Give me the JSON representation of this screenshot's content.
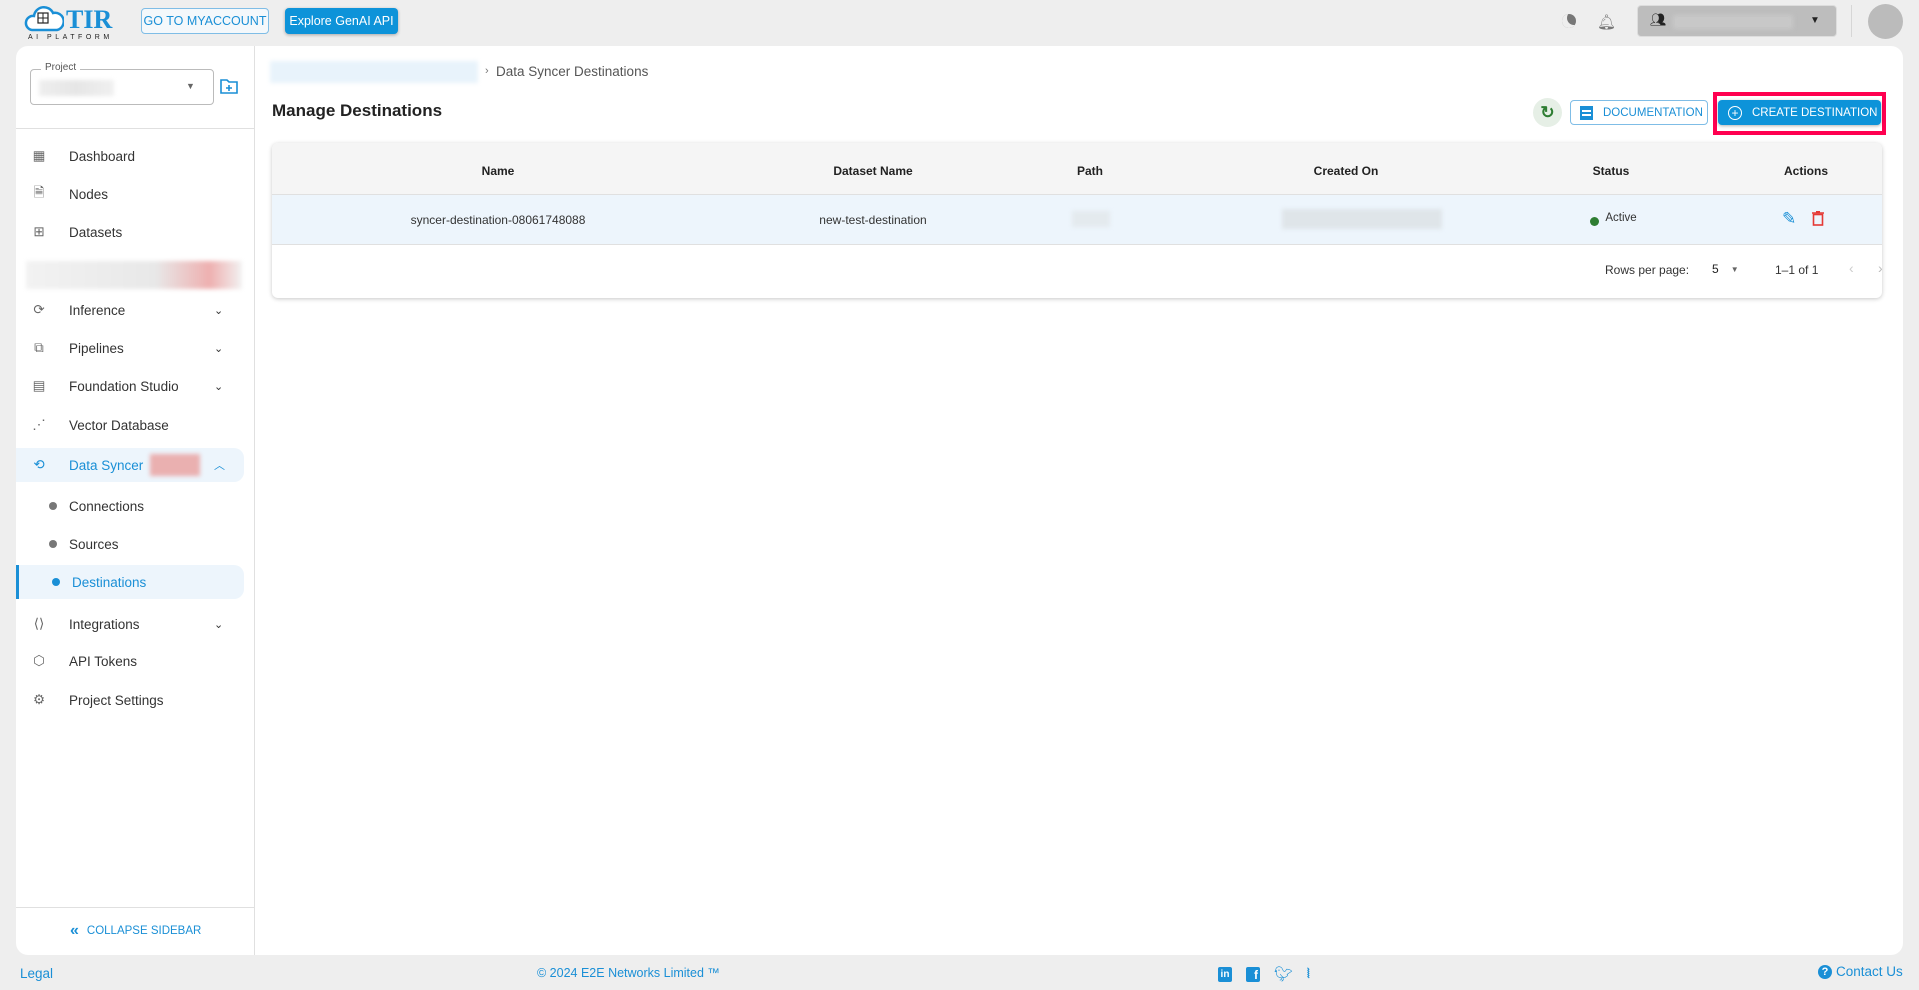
{
  "header": {
    "logo_text": "TIR",
    "logo_sub": "AI PLATFORM",
    "myaccount_label": "GO TO MYACCOUNT",
    "genai_label": "Explore GenAI API"
  },
  "sidebar": {
    "project_label": "Project",
    "items": [
      {
        "label": "Dashboard",
        "icon": "dashboard-icon"
      },
      {
        "label": "Nodes",
        "icon": "document-icon"
      },
      {
        "label": "Datasets",
        "icon": "grid-icon"
      },
      {
        "label": "Inference",
        "icon": "inference-icon"
      },
      {
        "label": "Pipelines",
        "icon": "pipeline-icon"
      },
      {
        "label": "Foundation Studio",
        "icon": "studio-icon"
      },
      {
        "label": "Vector Database",
        "icon": "vector-icon"
      },
      {
        "label": "Data Syncer",
        "icon": "sync-icon"
      },
      {
        "label": "Integrations",
        "icon": "integration-icon"
      },
      {
        "label": "API Tokens",
        "icon": "token-icon"
      },
      {
        "label": "Project Settings",
        "icon": "gear-icon"
      }
    ],
    "subitems": [
      {
        "label": "Connections"
      },
      {
        "label": "Sources"
      },
      {
        "label": "Destinations"
      }
    ],
    "collapse_label": "COLLAPSE SIDEBAR"
  },
  "main": {
    "breadcrumb_current": "Data Syncer Destinations",
    "title": "Manage Destinations",
    "documentation_label": "DOCUMENTATION",
    "create_label": "CREATE DESTINATION",
    "table": {
      "headers": [
        "Name",
        "Dataset Name",
        "Path",
        "Created On",
        "Status",
        "Actions"
      ],
      "rows": [
        {
          "name": "syncer-destination-08061748088",
          "dataset": "new-test-destination",
          "status": "Active"
        }
      ],
      "rows_per_page_label": "Rows per page:",
      "rows_per_page": "5",
      "range": "1–1 of 1"
    }
  },
  "footer": {
    "legal": "Legal",
    "copyright": "© 2024 E2E Networks Limited ™",
    "contact": "Contact Us"
  },
  "colors": {
    "accent": "#0d93d9",
    "active": "#2e7d32",
    "delete": "#e53935",
    "highlight": "#ff0050"
  }
}
